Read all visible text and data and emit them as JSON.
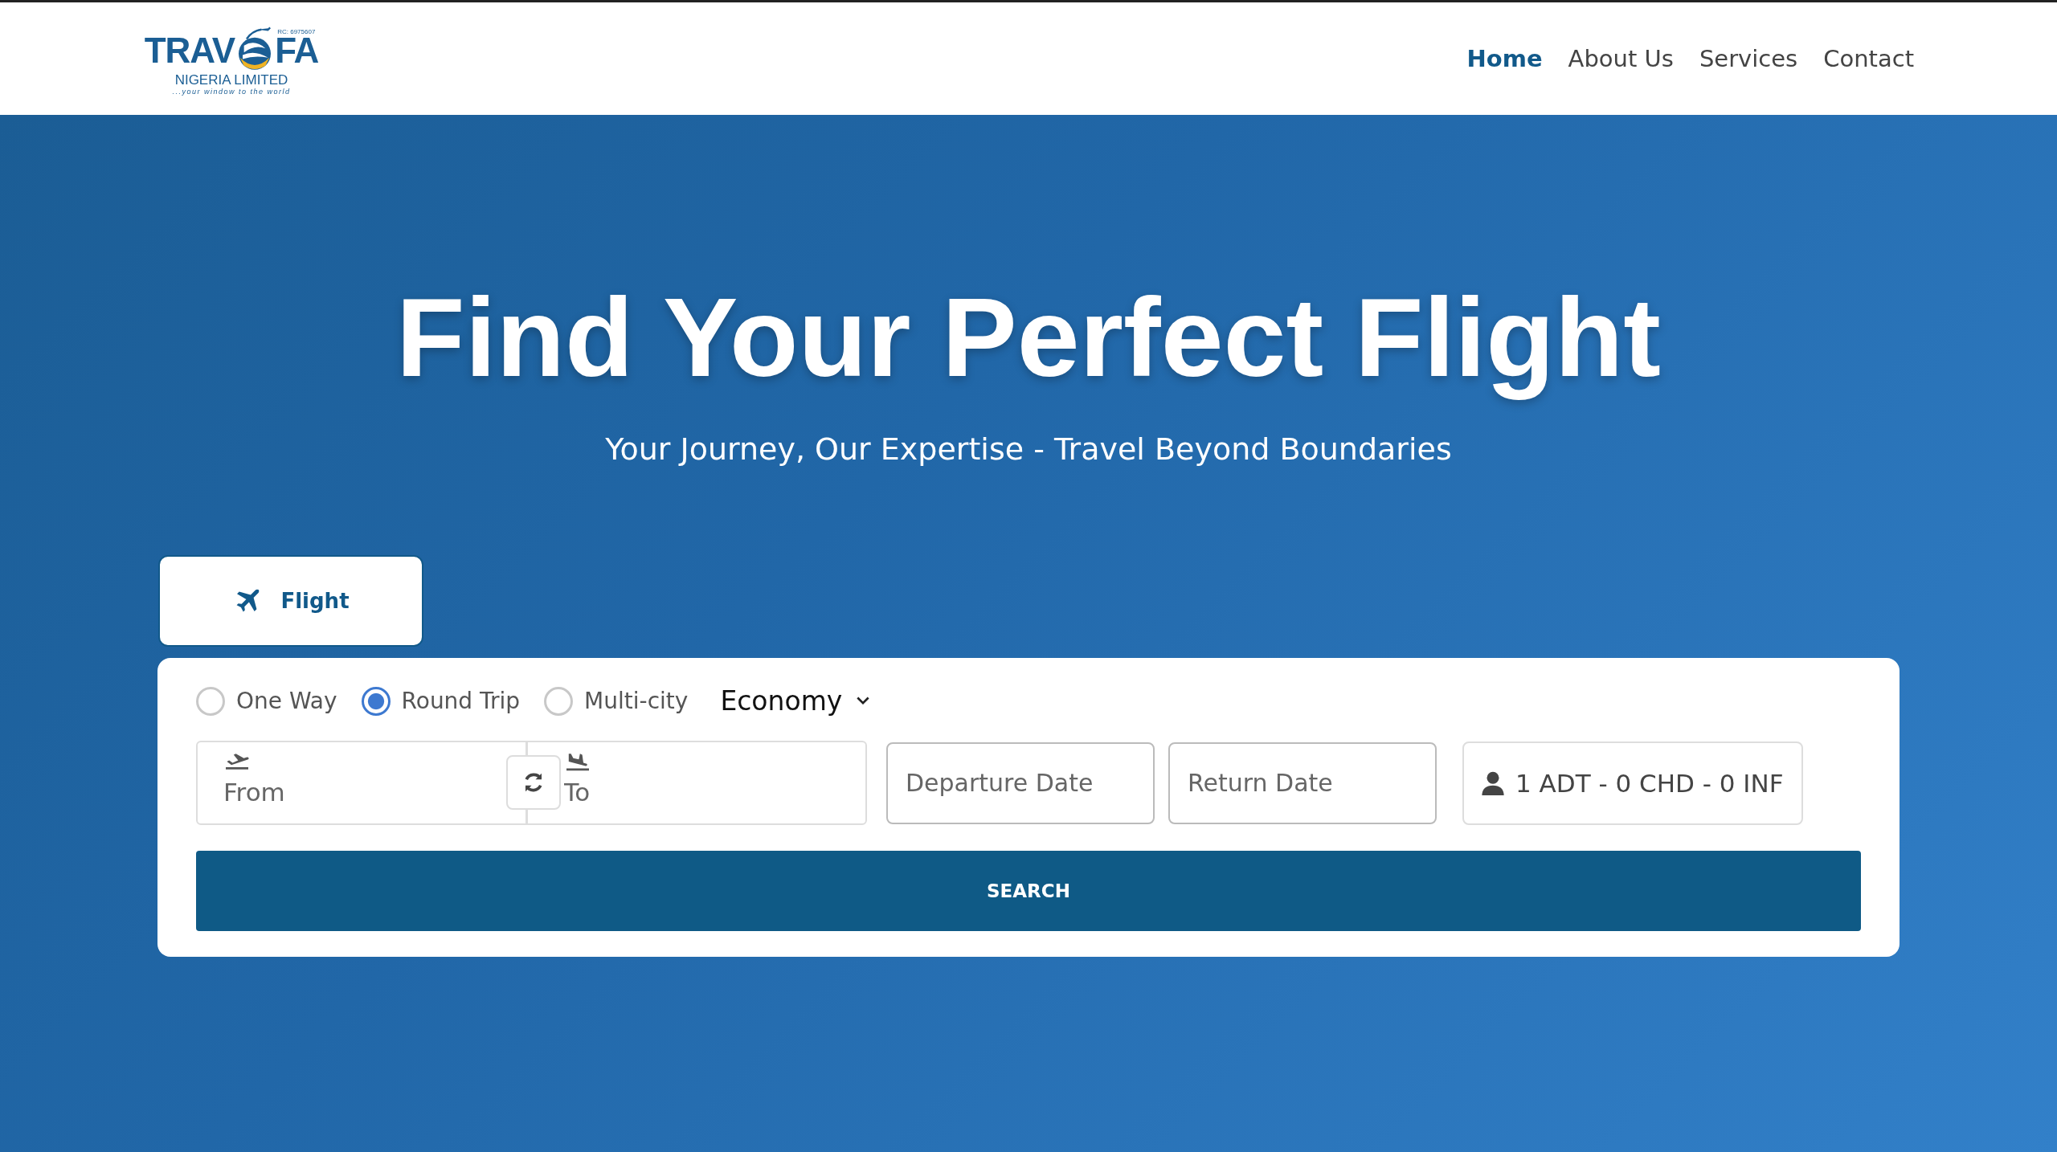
{
  "header": {
    "logo": {
      "left": "TRAV",
      "right": "FA",
      "registration": "RC: 6975607",
      "company": "NIGERIA LIMITED",
      "tagline": "...your window to the world"
    },
    "nav": [
      {
        "label": "Home",
        "selected": true
      },
      {
        "label": "About Us",
        "selected": false
      },
      {
        "label": "Services",
        "selected": false
      },
      {
        "label": "Contact",
        "selected": false
      }
    ]
  },
  "hero": {
    "title": "Find Your Perfect Flight",
    "subtitle": "Your Journey, Our Expertise - Travel Beyond Boundaries"
  },
  "tabs": [
    {
      "label": "Flight",
      "selected": true
    }
  ],
  "search_form": {
    "trip_types": [
      {
        "label": "One Way",
        "selected": false
      },
      {
        "label": "Round Trip",
        "selected": true
      },
      {
        "label": "Multi-city",
        "selected": false
      }
    ],
    "cabin_class": "Economy",
    "from": {
      "placeholder": "From"
    },
    "to": {
      "placeholder": "To"
    },
    "departure_date": {
      "placeholder": "Departure Date"
    },
    "return_date": {
      "placeholder": "Return Date"
    },
    "passengers": "1 ADT - 0 CHD - 0 INF",
    "search_button": "SEARCH"
  }
}
